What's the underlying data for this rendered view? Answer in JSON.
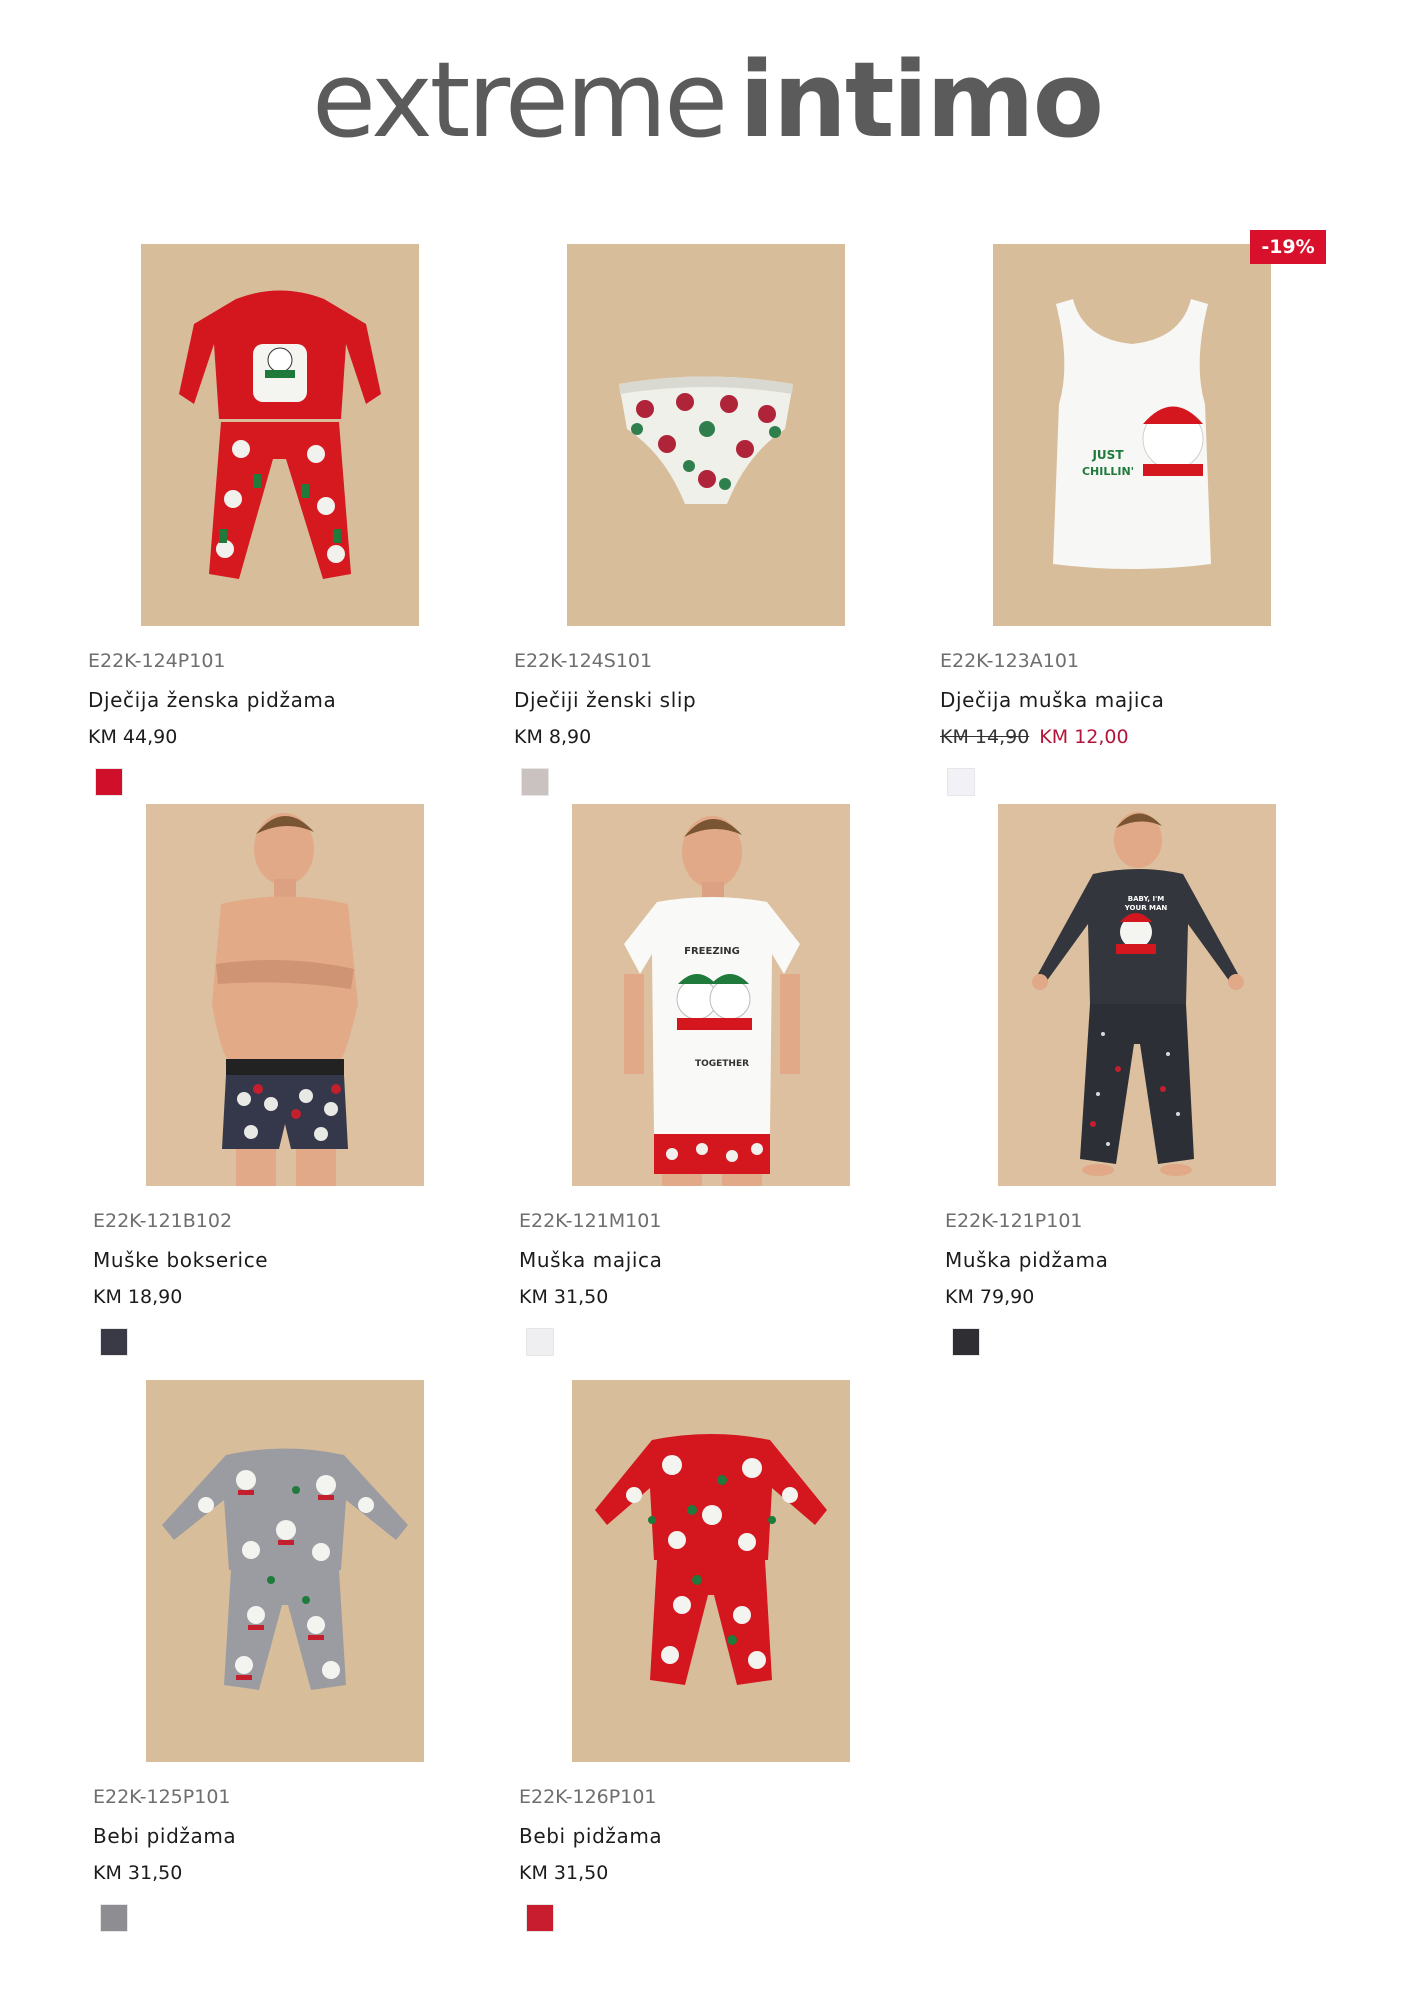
{
  "brand": {
    "part1": "extreme",
    "part2": "intimo"
  },
  "products": [
    {
      "sku": "E22K-124P101",
      "name": "Dječija ženska pidžama",
      "price": "KM 44,90",
      "swatch_color": "#d0102a",
      "image": "kids-girl-pajama-red"
    },
    {
      "sku": "E22K-124S101",
      "name": "Dječiji ženski slip",
      "price": "KM 8,90",
      "swatch_color": "#c9c2c0",
      "image": "kids-briefs-snowman-print"
    },
    {
      "sku": "E22K-123A101",
      "name": "Dječija muška majica",
      "price_old": "KM 14,90",
      "price_new": "KM 12,00",
      "badge": "-19%",
      "swatch_color": "#f2f2f6",
      "image": "kids-white-tank-just-chillin"
    },
    {
      "sku": "E22K-121B102",
      "name": "Muške bokserice",
      "price": "KM 18,90",
      "swatch_color": "#3a3a46",
      "image": "men-boxers-model"
    },
    {
      "sku": "E22K-121M101",
      "name": "Muška majica",
      "price": "KM 31,50",
      "swatch_color": "#efeff2",
      "image": "men-tshirt-freezing-together"
    },
    {
      "sku": "E22K-121P101",
      "name": "Muška pidžama",
      "price": "KM 79,90",
      "swatch_color": "#2e2e33",
      "image": "men-pajama-dark-grey"
    },
    {
      "sku": "E22K-125P101",
      "name": "Bebi pidžama",
      "price": "KM 31,50",
      "swatch_color": "#8d8d92",
      "image": "baby-pajama-grey"
    },
    {
      "sku": "E22K-126P101",
      "name": "Bebi pidžama",
      "price": "KM 31,50",
      "swatch_color": "#c81d2e",
      "image": "baby-pajama-red"
    }
  ],
  "product_3_text": {
    "line1": "JUST",
    "line2": "CHILLIN'"
  },
  "product_5_text": {
    "line1": "FREEZING",
    "line2": "TOGETHER"
  },
  "product_6_text": {
    "line1": "BABY, I'M",
    "line2": "YOUR MAN"
  }
}
